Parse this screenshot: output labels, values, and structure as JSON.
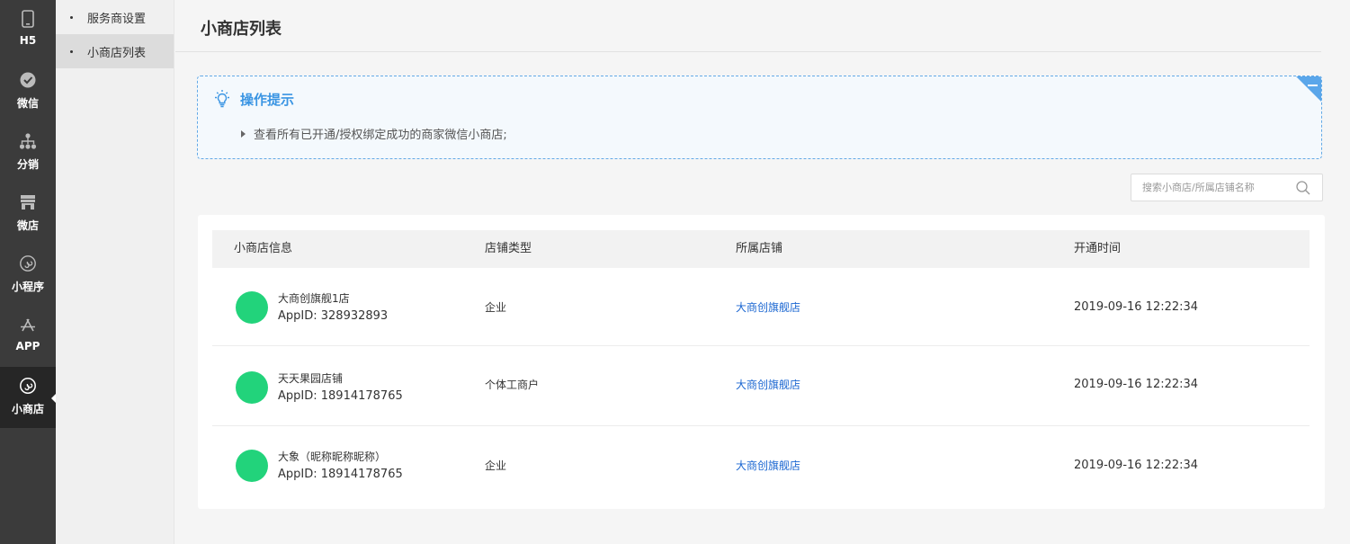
{
  "rail": {
    "items": [
      {
        "label": "H5",
        "icon": "phone-icon",
        "active": false
      },
      {
        "label": "微信",
        "icon": "wechat-check-icon",
        "active": false
      },
      {
        "label": "分销",
        "icon": "distribution-tree-icon",
        "active": false
      },
      {
        "label": "微店",
        "icon": "store-icon",
        "active": false
      },
      {
        "label": "小程序",
        "icon": "mini-program-icon",
        "active": false
      },
      {
        "label": "APP",
        "icon": "app-store-icon",
        "active": false
      },
      {
        "label": "小商店",
        "icon": "mini-shop-icon",
        "active": true
      }
    ]
  },
  "submenu": {
    "items": [
      {
        "label": "服务商设置",
        "active": false
      },
      {
        "label": "小商店列表",
        "active": true
      }
    ]
  },
  "page": {
    "title": "小商店列表"
  },
  "tips": {
    "title": "操作提示",
    "lines": [
      "查看所有已开通/授权绑定成功的商家微信小商店;"
    ],
    "accent": "#3a95e3"
  },
  "search": {
    "placeholder": "搜索小商店/所属店铺名称",
    "value": ""
  },
  "table": {
    "columns": [
      "小商店信息",
      "店铺类型",
      "所属店铺",
      "开通时间"
    ],
    "rows": [
      {
        "name": "大商创旗舰1店",
        "appid": "AppID:  328932893",
        "type": "企业",
        "store": "大商创旗舰店",
        "time": "2019-09-16 12:22:34"
      },
      {
        "name": "天天果园店铺",
        "appid": "AppID:  18914178765",
        "type": "个体工商户",
        "store": "大商创旗舰店",
        "time": "2019-09-16 12:22:34"
      },
      {
        "name": "大象（昵称昵称昵称）",
        "appid": "AppID:  18914178765",
        "type": "企业",
        "store": "大商创旗舰店",
        "time": "2019-09-16 12:22:34"
      }
    ]
  },
  "colors": {
    "avatar": "#22d37b",
    "link": "#1a66d1",
    "rail_bg": "#3b3b3b"
  }
}
